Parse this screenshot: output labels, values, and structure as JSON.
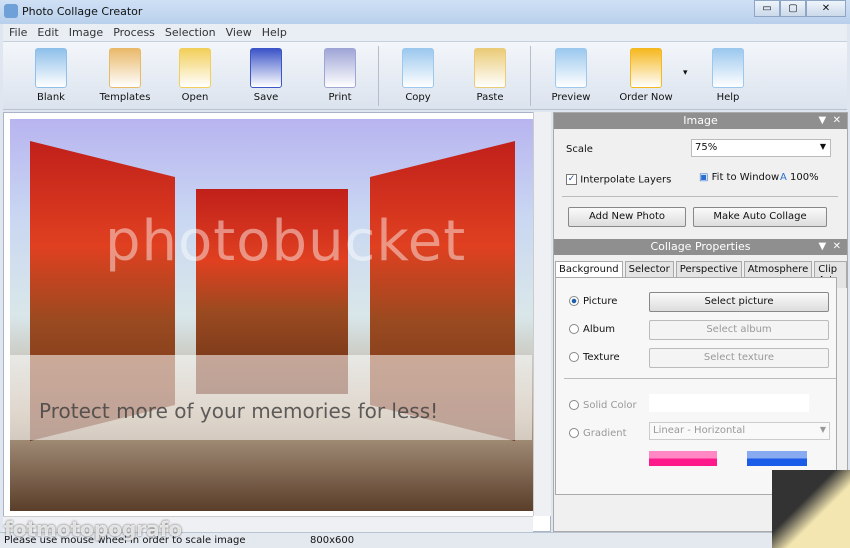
{
  "window": {
    "title": "Photo Collage Creator",
    "minimize": "▭",
    "maximize": "▢",
    "close": "✕"
  },
  "menu": [
    "File",
    "Edit",
    "Image",
    "Process",
    "Selection",
    "View",
    "Help"
  ],
  "toolbar": [
    {
      "label": "Blank",
      "icon": "blank-doc-icon",
      "color": "#8fc0ea"
    },
    {
      "label": "Templates",
      "icon": "palette-icon",
      "color": "#e9b96a"
    },
    {
      "label": "Open",
      "icon": "folder-open-icon",
      "color": "#f2cf5a"
    },
    {
      "label": "Save",
      "icon": "floppy-icon",
      "color": "#3c55c8"
    },
    {
      "label": "Print",
      "icon": "printer-icon",
      "color": "#9fa6d6"
    },
    {
      "label": "Copy",
      "icon": "copy-icon",
      "color": "#9cc8ee"
    },
    {
      "label": "Paste",
      "icon": "paste-icon",
      "color": "#eacb78"
    },
    {
      "label": "Preview",
      "icon": "preview-magnifier-icon",
      "color": "#9cc8ee"
    },
    {
      "label": "Order Now",
      "icon": "key-sun-icon",
      "color": "#f5b820"
    },
    {
      "label": "Help",
      "icon": "help-clipboard-icon",
      "color": "#9cc8ee"
    }
  ],
  "toolbar_dropdown": "▾",
  "watermark": {
    "logo": "photobucket",
    "banner": "Protect more of your memories for less!",
    "corner": "fotmotopografo"
  },
  "image_panel": {
    "title": "Image",
    "scale_label": "Scale",
    "scale_value": "75%",
    "interpolate_label": "Interpolate Layers",
    "interpolate_checked": true,
    "fit_label": "Fit to Window",
    "zoom100_label": "100%",
    "add_photo": "Add New Photo",
    "auto_collage": "Make Auto Collage"
  },
  "collage_panel": {
    "title": "Collage Properties",
    "tabs": [
      "Background",
      "Selector",
      "Perspective",
      "Atmosphere",
      "Clip Art"
    ],
    "active_tab": "Background",
    "options": [
      {
        "label": "Picture",
        "button": "Select picture",
        "selected": true
      },
      {
        "label": "Album",
        "button": "Select album"
      },
      {
        "label": "Texture",
        "button": "Select texture"
      }
    ],
    "solid_color_label": "Solid Color",
    "gradient_label": "Gradient",
    "gradient_value": "Linear - Horizontal",
    "gradient_color1": "#ff1a8c",
    "gradient_color2": "#1a5be8"
  },
  "panel_controls": {
    "menu": "▼",
    "close": "✕"
  },
  "status": {
    "hint": "Please use mouse wheel in order to scale image",
    "size": "800x600"
  }
}
